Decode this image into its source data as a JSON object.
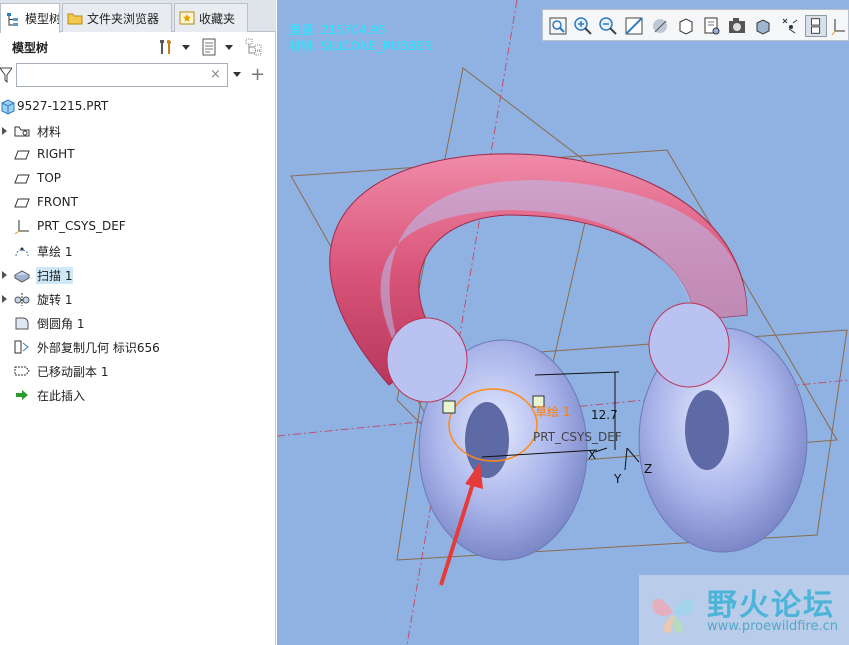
{
  "tabs": [
    {
      "label": "模型树",
      "icon": "model-tree-icon",
      "active": true
    },
    {
      "label": "文件夹浏览器",
      "icon": "folder-browser-icon",
      "active": false
    },
    {
      "label": "收藏夹",
      "icon": "favorites-icon",
      "active": false
    }
  ],
  "panel": {
    "title": "模型树",
    "filter": {
      "value": "",
      "placeholder": "",
      "clear_label": "×"
    }
  },
  "tree": {
    "root": {
      "label": "9527-1215.PRT",
      "icon": "part-icon"
    },
    "items": [
      {
        "label": "材料",
        "icon": "material-icon",
        "expandable": true
      },
      {
        "label": "RIGHT",
        "icon": "datum-plane-icon",
        "expandable": false
      },
      {
        "label": "TOP",
        "icon": "datum-plane-icon",
        "expandable": false
      },
      {
        "label": "FRONT",
        "icon": "datum-plane-icon",
        "expandable": false
      },
      {
        "label": "PRT_CSYS_DEF",
        "icon": "csys-icon",
        "expandable": false
      },
      {
        "label": "草绘 1",
        "icon": "sketch-icon",
        "expandable": false
      },
      {
        "label": "扫描 1",
        "icon": "sweep-icon",
        "expandable": true,
        "selected": true
      },
      {
        "label": "旋转 1",
        "icon": "revolve-icon",
        "expandable": true
      },
      {
        "label": "倒圆角 1",
        "icon": "round-icon",
        "expandable": false
      },
      {
        "label": "外部复制几何 标识656",
        "icon": "external-copy-icon",
        "expandable": false
      },
      {
        "label": "已移动副本 1",
        "icon": "moved-copy-icon",
        "expandable": false
      },
      {
        "label": "在此插入",
        "icon": "insert-here-arrow-icon",
        "expandable": false
      }
    ]
  },
  "viewport": {
    "info_lines": [
      "重量: 215704.95",
      "材料: SILICONE_RUBBER"
    ],
    "toolbar": [
      "refit-icon",
      "zoom-in-icon",
      "zoom-out-icon",
      "repaint-icon",
      "display-style-icon",
      "saved-views-icon",
      "view-manager-icon",
      "perspective-icon",
      "spin-center-icon",
      "annotation-display-icon",
      "datum-display-icon",
      "csys-display-icon"
    ],
    "annotations": {
      "sketch": "草绘 1",
      "dimension": "12.7",
      "csys": "PRT_CSYS_DEF",
      "x": "X",
      "y": "Y",
      "z": "Z"
    },
    "colors": {
      "background": "#8fb2e3",
      "solid": "#aab5ea",
      "highlight": "#d9567a",
      "datum": "#8b6a4a",
      "arrow": "#e53b3b",
      "info": "#29e7ff"
    }
  },
  "watermark": {
    "title": "野火论坛",
    "url": "www.proewildfire.cn"
  }
}
